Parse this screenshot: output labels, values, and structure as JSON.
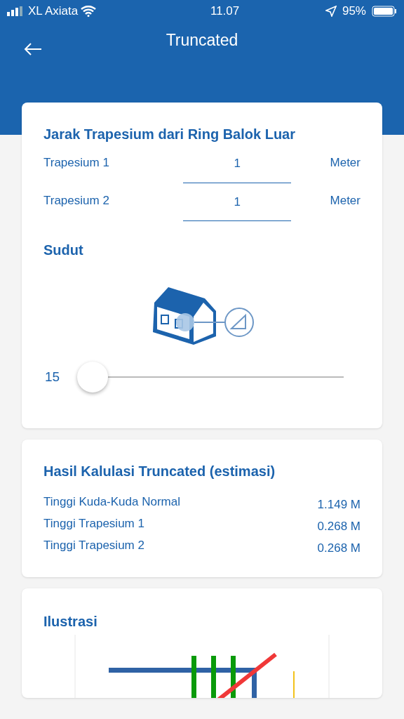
{
  "status_bar": {
    "carrier": "XL Axiata",
    "time": "11.07",
    "battery": "95%"
  },
  "header": {
    "title": "Truncated"
  },
  "distance_card": {
    "title": "Jarak Trapesium dari Ring Balok Luar",
    "fields": [
      {
        "label": "Trapesium 1",
        "value": "1",
        "unit": "Meter"
      },
      {
        "label": "Trapesium 2",
        "value": "1",
        "unit": "Meter"
      }
    ],
    "angle_title": "Sudut",
    "slider": {
      "reading": "15",
      "level": 0
    }
  },
  "result_card": {
    "title": "Hasil Kalulasi Truncated (estimasi)",
    "rows": [
      {
        "label": "Tinggi Kuda-Kuda Normal",
        "value": "1.149 M"
      },
      {
        "label": "Tinggi Trapesium 1",
        "value": "0.268 M"
      },
      {
        "label": "Tinggi Trapesium 2",
        "value": "0.268 M"
      }
    ]
  },
  "illustration_card": {
    "title": "Ilustrasi"
  }
}
